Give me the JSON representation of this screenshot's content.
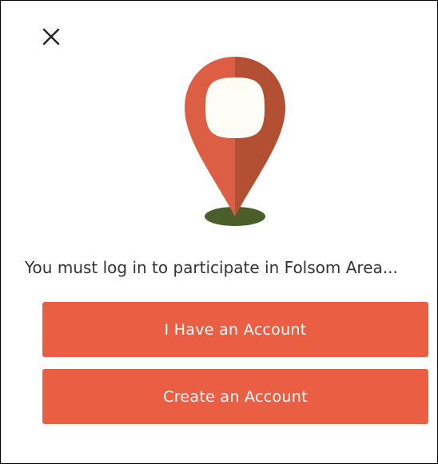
{
  "dialog": {
    "message": "You must log in to participate in Folsom Area...",
    "buttons": {
      "have_account": "I Have an Account",
      "create_account": "Create an Account"
    },
    "icons": {
      "close": "close-icon",
      "illustration": "location-pin-icon"
    },
    "colors": {
      "accent": "#EA5F44",
      "pin_light": "#DC5E44",
      "pin_dark": "#B35033",
      "shadow": "#4B5E2A"
    }
  }
}
